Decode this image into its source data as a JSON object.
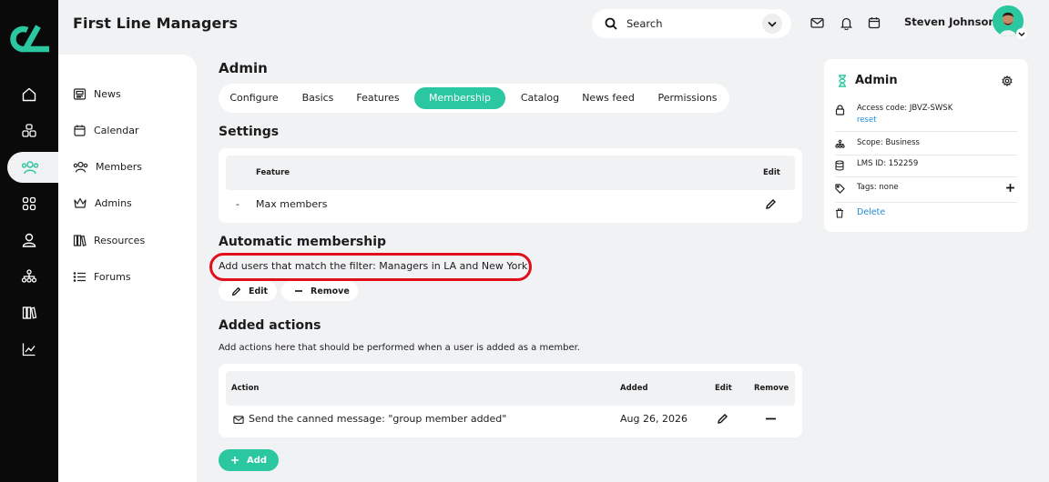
{
  "header": {
    "group_title": "First Line Managers",
    "search_placeholder": "Search",
    "user_name": "Steven Johnson"
  },
  "sidebar": {
    "items": [
      {
        "label": "News",
        "icon": "newspaper-icon"
      },
      {
        "label": "Calendar",
        "icon": "calendar-icon"
      },
      {
        "label": "Members",
        "icon": "members-icon"
      },
      {
        "label": "Admins",
        "icon": "crown-icon"
      },
      {
        "label": "Resources",
        "icon": "books-icon"
      },
      {
        "label": "Forums",
        "icon": "list-icon"
      }
    ]
  },
  "admin": {
    "title": "Admin",
    "tabs": [
      {
        "label": "Configure",
        "active": false
      },
      {
        "label": "Basics",
        "active": false
      },
      {
        "label": "Features",
        "active": false
      },
      {
        "label": "Membership",
        "active": true
      },
      {
        "label": "Catalog",
        "active": false
      },
      {
        "label": "News feed",
        "active": false
      },
      {
        "label": "Permissions",
        "active": false
      }
    ]
  },
  "settings": {
    "title": "Settings",
    "columns": [
      "Feature",
      "Edit"
    ],
    "rows": [
      {
        "bullet": "-",
        "feature": "Max members"
      }
    ]
  },
  "automatic": {
    "title": "Automatic membership",
    "text": "Add users that match the filter: Managers in LA and New York",
    "edit_label": "Edit",
    "remove_label": "Remove"
  },
  "actions": {
    "title": "Added actions",
    "description": "Add actions here that should be performed when a user is added as a member.",
    "columns": [
      "Action",
      "Added",
      "Edit",
      "Remove"
    ],
    "rows": [
      {
        "action": "Send the canned message: \"group member added\"",
        "added": "Aug 26, 2026"
      }
    ],
    "add_label": "Add"
  },
  "info_card": {
    "title": "Admin",
    "access_code_label": "Access code: JBVZ-SWSK",
    "reset_label": "reset",
    "scope_label": "Scope: Business",
    "lms_label": "LMS ID: 152259",
    "tags_label": "Tags: none",
    "delete_label": "Delete"
  },
  "colors": {
    "accent": "#2bc7a0",
    "rail": "#0a0a0a",
    "highlight": "#e10f1a",
    "link": "#1e8fd8",
    "background": "#f1f2f4"
  }
}
